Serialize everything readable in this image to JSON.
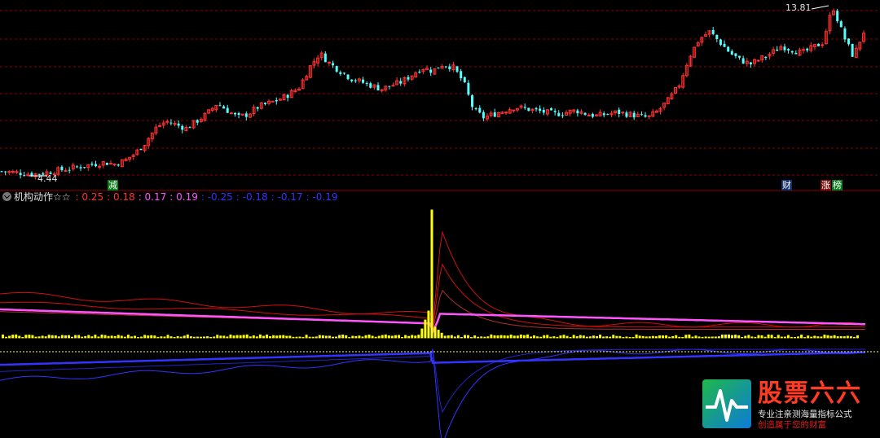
{
  "colors": {
    "background": "#000000",
    "up": "#ff3232",
    "down": "#54ffff",
    "grid": "#8b0000",
    "yellow_bar": "#ffff00",
    "magenta_line": "#ff55ff",
    "blue_line": "#3333ff",
    "red_line": "#d01010"
  },
  "price_panel": {
    "high_label": "13.81",
    "low_label": "4.44",
    "markers": [
      {
        "text": "减",
        "style": "green"
      },
      {
        "text": "财",
        "style": "blue"
      },
      {
        "text": "涨",
        "style": "red"
      },
      {
        "text": "榜",
        "style": "green"
      }
    ]
  },
  "indicator": {
    "title": "机构动作☆☆",
    "values": [
      {
        "text": ": 0.25",
        "color": "#ff3232"
      },
      {
        "text": ": 0.18",
        "color": "#ff3232"
      },
      {
        "text": ": 0.17",
        "color": "#ff55ff"
      },
      {
        "text": ": 0.19",
        "color": "#ff55ff"
      },
      {
        "text": ": -0.25",
        "color": "#3333ff"
      },
      {
        "text": ": -0.18",
        "color": "#3333ff"
      },
      {
        "text": ": -0.17",
        "color": "#3333ff"
      },
      {
        "text": ": -0.19",
        "color": "#3333ff"
      }
    ]
  },
  "logo": {
    "brand": "股票六六",
    "tagline": "专业注亲测海量指标公式",
    "slogan": "创造属于您的财富"
  },
  "chart_data": {
    "type": "candlestick",
    "price_range": [
      4.44,
      13.81
    ],
    "close_path": [
      4.6,
      4.55,
      4.5,
      4.44,
      4.5,
      4.6,
      4.7,
      4.8,
      4.9,
      5.0,
      5.1,
      5.0,
      5.2,
      5.6,
      6.2,
      7.0,
      7.4,
      7.2,
      7.0,
      7.4,
      7.8,
      8.4,
      8.0,
      7.6,
      7.8,
      8.2,
      8.4,
      8.6,
      8.9,
      9.3,
      10.4,
      11.2,
      10.6,
      10.2,
      9.8,
      9.6,
      9.4,
      9.2,
      9.4,
      9.6,
      10.0,
      10.4,
      10.2,
      10.6,
      10.4,
      9.6,
      8.0,
      7.6,
      7.8,
      8.0,
      8.2,
      8.1,
      8.0,
      7.9,
      7.8,
      7.9,
      8.0,
      7.8,
      7.7,
      7.8,
      7.9,
      7.8,
      7.7,
      7.6,
      8.0,
      8.6,
      9.4,
      11.0,
      12.0,
      12.4,
      11.8,
      11.2,
      10.8,
      10.6,
      10.9,
      11.2,
      11.6,
      11.4,
      11.2,
      11.5,
      11.8,
      13.81,
      12.2,
      11.0,
      12.4
    ],
    "indicator_range": [
      -0.45,
      0.6
    ],
    "bars_spike": 0.58
  }
}
